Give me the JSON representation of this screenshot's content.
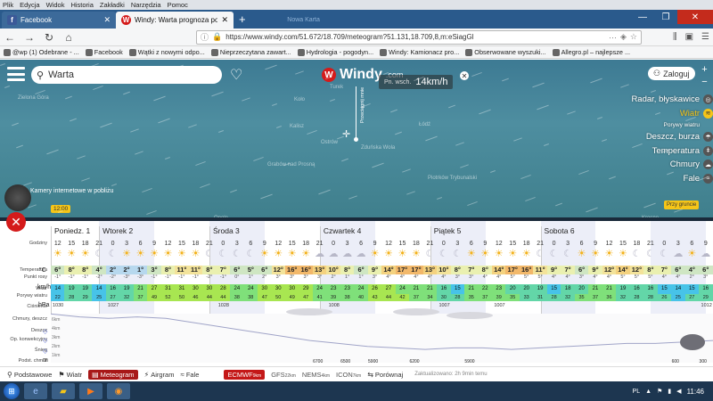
{
  "browser": {
    "menu": [
      "Plik",
      "Edycja",
      "Widok",
      "Historia",
      "Zakładki",
      "Narzędzia",
      "Pomoc"
    ],
    "tabs": [
      {
        "title": "Facebook",
        "active": false
      },
      {
        "title": "Windy: Warta prognoza pogod",
        "active": true
      }
    ],
    "ghost_tab": "Nowa Karta",
    "url": "https://www.windy.com/51.672/18.709/meteogram?51.131,18.709,8,m:eSiagGl",
    "bookmarks": [
      "@wp (1) Odebrane - ...",
      "Facebook",
      "Wątki z nowymi odpo...",
      "Nieprzeczytana zawart...",
      "Hydrologia - pogodyn...",
      "Windy: Kamionacz pro...",
      "Obserwowane wyszuki...",
      "Allegro.pl – najlepsze ..."
    ]
  },
  "map": {
    "search_value": "Warta",
    "logo_text": "Windy",
    "logo_suffix": ".com",
    "wind_dir": "Pn. wsch.",
    "wind_speed": "14km/h",
    "pin_label": "Przeciągnij mnie",
    "login_label": "Zaloguj",
    "layers": [
      {
        "label": "Radar, błyskawice",
        "sub": false,
        "active": false,
        "icon": "radar-icon"
      },
      {
        "label": "Wiatr",
        "sub": false,
        "active": true,
        "icon": "wind-icon"
      },
      {
        "label": "Porywy wiatru",
        "sub": true,
        "active": false,
        "icon": ""
      },
      {
        "label": "Deszcz, burza",
        "sub": false,
        "active": false,
        "icon": "rain-icon"
      },
      {
        "label": "Temperatura",
        "sub": false,
        "active": false,
        "icon": "thermometer-icon"
      },
      {
        "label": "Chmury",
        "sub": false,
        "active": false,
        "icon": "cloud-icon"
      },
      {
        "label": "Fale",
        "sub": false,
        "active": false,
        "icon": "wave-icon"
      }
    ],
    "webcam_label": "Kamery internetowe w pobliżu",
    "time_badge": "12:00",
    "ground_btn": "Przy gruncie",
    "cities": [
      "Zielona Góra",
      "Turek",
      "Koło",
      "Kalisz",
      "Ostrów",
      "Zduńska Wola",
      "Łódź",
      "Grabów nad Prosną",
      "Piotrków Trybunalski",
      "Opole",
      "Częstochowa",
      "Krosno"
    ]
  },
  "meteogram": {
    "days": [
      "Poniedz. 1",
      "Wtorek 2",
      "Środa 3",
      "Czwartek 4",
      "Piątek 5",
      "Sobota 6"
    ],
    "row_labels": {
      "hours": "Godziny",
      "temp": "Temperatura",
      "dew": "Punkt rosy",
      "wind": "Wiatr",
      "gust": "Porywy wiatru",
      "pressure": "Ciśnienie",
      "clouds": "Chmury, deszcz",
      "rain": "Deszcz",
      "convective": "Op. konwekcyjny",
      "snow": "Śnieg",
      "base": "Podst. chmur"
    },
    "units": {
      "temp": "°C",
      "wind": "km/h",
      "pressure": "hPa",
      "base": "m"
    },
    "hours": [
      "12",
      "15",
      "18",
      "21",
      "0",
      "3",
      "6",
      "9",
      "12",
      "15",
      "18",
      "21",
      "0",
      "3",
      "6",
      "9",
      "12",
      "15",
      "18",
      "21",
      "0",
      "3",
      "6",
      "9",
      "12",
      "15",
      "18",
      "21",
      "0",
      "3",
      "6",
      "9",
      "12",
      "15",
      "18",
      "21",
      "0",
      "3",
      "6",
      "9",
      "12",
      "15",
      "18",
      "21",
      "0",
      "3",
      "6",
      "9"
    ],
    "sky": [
      "sun",
      "sun",
      "sun",
      "moon",
      "moon",
      "sun",
      "sun",
      "sun",
      "sun",
      "sun",
      "sun",
      "moon",
      "moon",
      "moon",
      "moon",
      "sun",
      "sun",
      "sun",
      "sun",
      "cloud",
      "cloud",
      "cloud",
      "cloud",
      "sun",
      "sun",
      "sun",
      "sun",
      "moon",
      "moon",
      "moon",
      "sun",
      "sun",
      "sun",
      "sun",
      "sun",
      "moon",
      "moon",
      "moon",
      "sun",
      "sun",
      "sun",
      "sun",
      "moon",
      "moon",
      "moon",
      "cloud",
      "sun",
      "cloud"
    ],
    "temps": [
      "6°",
      "8°",
      "8°",
      "4°",
      "2°",
      "2°",
      "1°",
      "3°",
      "8°",
      "11°",
      "11°",
      "8°",
      "7°",
      "6°",
      "5°",
      "6°",
      "12°",
      "16°",
      "16°",
      "13°",
      "10°",
      "8°",
      "6°",
      "9°",
      "14°",
      "17°",
      "17°",
      "13°",
      "10°",
      "8°",
      "7°",
      "8°",
      "14°",
      "17°",
      "16°",
      "11°",
      "9°",
      "7°",
      "6°",
      "9°",
      "12°",
      "14°",
      "12°",
      "8°",
      "7°",
      "6°",
      "4°",
      "6°"
    ],
    "dews": [
      "-1°",
      "-1°",
      "-1°",
      "-2°",
      "-2°",
      "-3°",
      "-3°",
      "-1°",
      "-1°",
      "-1°",
      "-1°",
      "-2°",
      "-1°",
      "0°",
      "1°",
      "2°",
      "3°",
      "3°",
      "3°",
      "3°",
      "2°",
      "1°",
      "1°",
      "3°",
      "4°",
      "4°",
      "4°",
      "4°",
      "4°",
      "3°",
      "3°",
      "4°",
      "4°",
      "5°",
      "5°",
      "5°",
      "4°",
      "4°",
      "3°",
      "4°",
      "4°",
      "5°",
      "5°",
      "5°",
      "4°",
      "4°",
      "2°",
      "3°"
    ],
    "winds": [
      "14",
      "19",
      "19",
      "14",
      "16",
      "19",
      "21",
      "27",
      "31",
      "31",
      "30",
      "30",
      "28",
      "24",
      "24",
      "30",
      "30",
      "30",
      "29",
      "24",
      "23",
      "23",
      "24",
      "26",
      "27",
      "24",
      "21",
      "21",
      "16",
      "15",
      "21",
      "22",
      "23",
      "20",
      "20",
      "19",
      "15",
      "18",
      "20",
      "21",
      "21",
      "19",
      "16",
      "16",
      "15",
      "14",
      "15",
      "16"
    ],
    "gusts": [
      "22",
      "28",
      "29",
      "25",
      "27",
      "32",
      "37",
      "49",
      "52",
      "50",
      "46",
      "44",
      "44",
      "38",
      "38",
      "47",
      "50",
      "49",
      "47",
      "41",
      "39",
      "38",
      "40",
      "43",
      "44",
      "42",
      "37",
      "34",
      "30",
      "28",
      "35",
      "37",
      "39",
      "35",
      "33",
      "31",
      "28",
      "32",
      "35",
      "37",
      "36",
      "32",
      "28",
      "28",
      "26",
      "25",
      "27",
      "29"
    ],
    "pressure_labels": [
      "1030",
      "1027",
      "1028",
      "1008",
      "1007",
      "1007",
      "1012"
    ],
    "pressure_trend": [
      1030,
      1028,
      1027,
      1028,
      1027,
      1024,
      1021,
      1018,
      1015,
      1012,
      1010,
      1008,
      1007,
      1006,
      1007,
      1007,
      1006,
      1007,
      1008,
      1009,
      1010,
      1010,
      1011,
      1012
    ],
    "altitudes": [
      "6km",
      "4km",
      "3km",
      "2km",
      "1km"
    ],
    "base_marks": [
      "6700",
      "6500",
      "5900",
      "6200",
      "5900",
      "600",
      "300"
    ]
  },
  "bottom": {
    "modes": [
      {
        "label": "Podstawowe",
        "on": false,
        "icon": "basic-icon"
      },
      {
        "label": "Wiatr",
        "on": false,
        "icon": "wind-icon"
      },
      {
        "label": "Meteogram",
        "on": true,
        "icon": "meteogram-icon"
      },
      {
        "label": "Airgram",
        "on": false,
        "icon": "airgram-icon"
      },
      {
        "label": "Fale",
        "on": false,
        "icon": "wave-icon"
      }
    ],
    "models": [
      {
        "label": "ECMWF",
        "res": "9km",
        "on": true
      },
      {
        "label": "GFS",
        "res": "22km",
        "on": false
      },
      {
        "label": "NEMS",
        "res": "4km",
        "on": false
      },
      {
        "label": "ICON",
        "res": "7km",
        "on": false
      }
    ],
    "compare": "Porównaj",
    "updated": "Zaktualizowano: 2h 9min temu"
  },
  "taskbar": {
    "clock": "11:46",
    "lang": "PL"
  },
  "colors": {
    "accent": "#d41b1b",
    "yellow": "#f5c518"
  }
}
